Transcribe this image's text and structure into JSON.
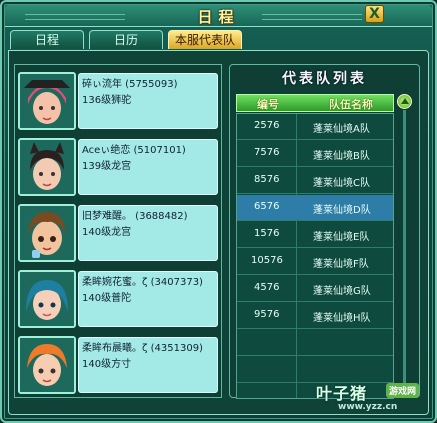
{
  "window": {
    "title": "日程",
    "close_label": "X"
  },
  "tabs": [
    {
      "label": "日程"
    },
    {
      "label": "日历"
    },
    {
      "label": "本服代表队"
    }
  ],
  "members": [
    {
      "name": "碎ぃ流年 (5755093)",
      "level": "136级狮驼"
    },
    {
      "name": "Aceぃ绝恋 (5107101)",
      "level": "139级龙宫"
    },
    {
      "name": "旧梦难醒。 (3688482)",
      "level": "140级龙宫"
    },
    {
      "name": "柔眸婉花蜜。ζ (3407373)",
      "level": "140级普陀"
    },
    {
      "name": "柔眸布晨曦。ζ (4351309)",
      "level": "140级方寸"
    }
  ],
  "team_list": {
    "title": "代表队列表",
    "columns": {
      "id": "编号",
      "name": "队伍名称"
    },
    "rows": [
      {
        "id": "2576",
        "name": "蓬莱仙境A队"
      },
      {
        "id": "7576",
        "name": "蓬莱仙境B队"
      },
      {
        "id": "8576",
        "name": "蓬莱仙境C队"
      },
      {
        "id": "6576",
        "name": "蓬莱仙境D队"
      },
      {
        "id": "1576",
        "name": "蓬莱仙境E队"
      },
      {
        "id": "10576",
        "name": "蓬莱仙境F队"
      },
      {
        "id": "4576",
        "name": "蓬莱仙境G队"
      },
      {
        "id": "9576",
        "name": "蓬莱仙境H队"
      }
    ],
    "selected_index": 3
  },
  "watermark": {
    "brand": "叶子猪",
    "badge": "游戏网",
    "url": "www.yzz.cn"
  },
  "colors": {
    "accent": "#ffe27a",
    "selected_row": "#2e7da8",
    "panel": "#0f4338"
  }
}
